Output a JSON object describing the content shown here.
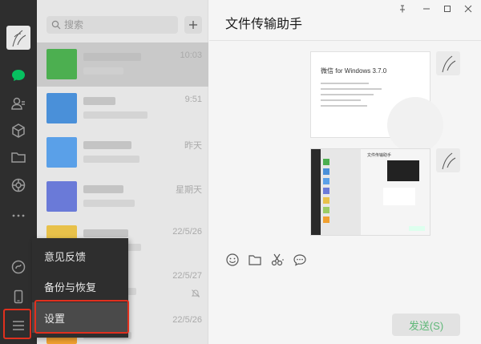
{
  "search": {
    "placeholder": "搜索"
  },
  "chat_list": {
    "items": [
      {
        "time": "10:03",
        "selected": true,
        "avatar_color": "#4caf50"
      },
      {
        "time": "9:51",
        "avatar_color": "#4a90d9"
      },
      {
        "time": "昨天",
        "avatar_color": "#5aa0e8"
      },
      {
        "time": "星期天",
        "avatar_color": "#6a7ad8"
      },
      {
        "time": "22/5/26",
        "avatar_color": "#e8c14a"
      },
      {
        "time": "22/5/27",
        "avatar_color": "#d8d8d8"
      },
      {
        "time": "22/5/26",
        "avatar_color": "#f0a030"
      }
    ]
  },
  "menu": {
    "items": [
      {
        "label": "意见反馈"
      },
      {
        "label": "备份与恢复"
      },
      {
        "label": "设置"
      }
    ]
  },
  "chat": {
    "title": "文件传输助手",
    "screenshot_title": "微信 for Windows 3.7.0",
    "screenshot2_title": "文件传输助手",
    "send_label": "发送(S)"
  },
  "colors": {
    "sidebar": "#2e2e2e",
    "accent_green": "#07c160",
    "highlight_red": "#e0301e",
    "send_text": "#5fb878"
  }
}
